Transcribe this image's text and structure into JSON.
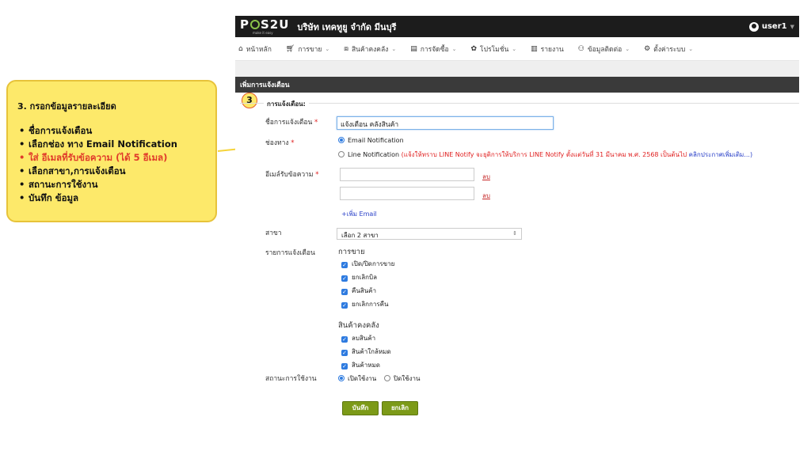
{
  "callout": {
    "title": "3. กรอกข้อมูลรายละเอียด",
    "items": [
      "ชื่อการแจ้งเตือน",
      "เลือกช่อง ทาง Email Notification",
      "ใส่ อีเมลที่รับข้อความ (ได้ 5 อีเมล)",
      "เลือกสาขา,การแจ้งเตือน",
      "สถานะการใช้งาน",
      "บันทึก ข้อมูล"
    ],
    "step_number": "3"
  },
  "topbar": {
    "logo": "POS2U",
    "logo_tagline": "make it easy",
    "company": "บริษัท เทคทูยู จำกัด มีนบุรี",
    "user": "user1"
  },
  "nav": {
    "items": [
      {
        "label": "หน้าหลัก",
        "icon": "home-icon"
      },
      {
        "label": "การขาย",
        "icon": "cart-icon"
      },
      {
        "label": "สินค้าคงคลัง",
        "icon": "cubes-icon"
      },
      {
        "label": "การจัดซื้อ",
        "icon": "document-icon"
      },
      {
        "label": "โปรโมชั่น",
        "icon": "gift-icon"
      },
      {
        "label": "รายงาน",
        "icon": "bar-chart-icon"
      },
      {
        "label": "ข้อมูลติดต่อ",
        "icon": "users-icon"
      },
      {
        "label": "ตั้งค่าระบบ",
        "icon": "gear-icon"
      }
    ]
  },
  "panel": {
    "heading": "เพิ่มการแจ้งเตือน",
    "legend": "การแจ้งเตือน:"
  },
  "form": {
    "name_label": "ชื่อการแจ้งเตือน",
    "name_value": "แจ้งเตือน คลังสินค้า",
    "channel_label": "ช่องทาง",
    "channel_email": "Email Notification",
    "channel_line": "Line Notification",
    "line_note": "(แจ้งให้ทราบ LINE Notify จะยุติการให้บริการ LINE Notify ตั้งแต่วันที่ 31 มีนาคม พ.ศ. 2568 เป็นต้นไป",
    "line_note_link": "คลิกประกาศเพิ่มเติม...)",
    "email_label": "อีเมล์รับข้อความ",
    "email_values": [
      "",
      ""
    ],
    "delete_label": "ลบ",
    "add_email": "+เพิ่ม Email",
    "branch_label": "สาขา",
    "branch_value": "เลือก 2 สาขา",
    "notify_label": "รายการแจ้งเตือน",
    "sales_group": "การขาย",
    "sales_items": [
      "เปิด/ปิดการขาย",
      "ยกเลิกบิล",
      "คืนสินค้า",
      "ยกเลิกการคืน"
    ],
    "stock_group": "สินค้าคงคลัง",
    "stock_items": [
      "ลบสินค้า",
      "สินค้าใกล้หมด",
      "สินค้าหมด"
    ],
    "status_label": "สถานะการใช้งาน",
    "status_on": "เปิดใช้งาน",
    "status_off": "ปิดใช้งาน",
    "save_button": "บันทึก",
    "cancel_button": "ยกเลิก"
  },
  "colors": {
    "callout_bg": "#fde96a",
    "topbar_bg": "#1c1c1c",
    "button_green": "#7c9a18",
    "accent_blue": "#2e7be0",
    "note_red": "#e02020"
  }
}
